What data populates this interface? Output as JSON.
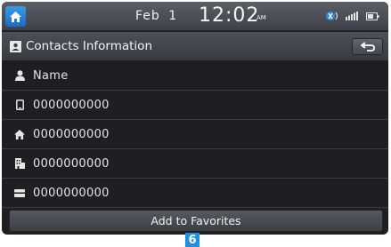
{
  "status_bar": {
    "date_month": "Feb",
    "date_day": "1",
    "time": "12:02",
    "ampm": "AM",
    "icons": [
      "bluetooth-phone-icon",
      "signal-strength-icon",
      "battery-icon"
    ]
  },
  "header": {
    "title": "Contacts Information",
    "title_icon": "contact-card-icon",
    "back_icon": "back-arrow-icon"
  },
  "contact": {
    "rows": [
      {
        "icon": "person-icon",
        "label": "Name"
      },
      {
        "icon": "mobile-phone-icon",
        "label": "0000000000"
      },
      {
        "icon": "home-icon",
        "label": "0000000000"
      },
      {
        "icon": "office-icon",
        "label": "0000000000"
      },
      {
        "icon": "other-number-icon",
        "label": "0000000000"
      }
    ]
  },
  "actions": {
    "add_to_favorites": "Add to Favorites"
  },
  "callout": {
    "number": "6"
  },
  "colors": {
    "accent": "#1f8fe0",
    "background": "#1d1f23"
  }
}
